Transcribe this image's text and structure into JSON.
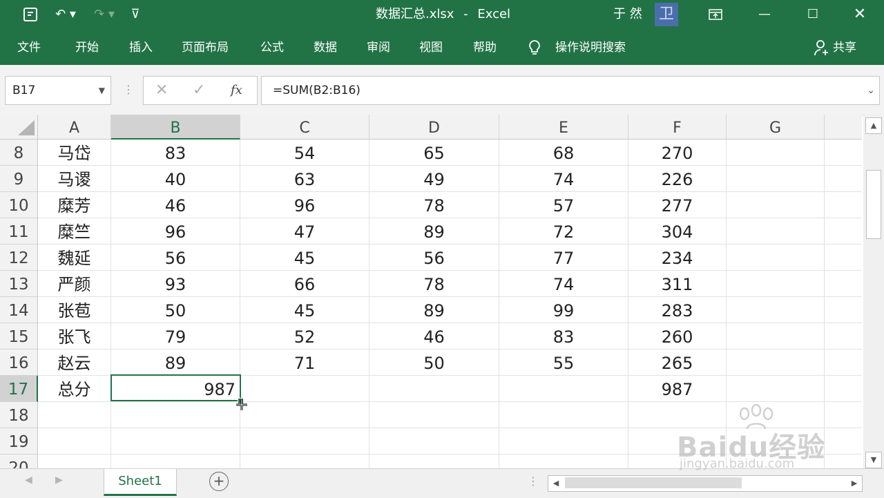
{
  "title_bar": {
    "filename": "数据汇总.xlsx",
    "separator": "-",
    "app": "Excel",
    "user": "于 然",
    "user_badge": "卫"
  },
  "ribbon": {
    "tabs": [
      "文件",
      "开始",
      "插入",
      "页面布局",
      "公式",
      "数据",
      "审阅",
      "视图",
      "帮助"
    ],
    "tell_me": "操作说明搜索",
    "share": "共享"
  },
  "formula_bar": {
    "name_box": "B17",
    "fx_label": "fx",
    "formula": "=SUM(B2:B16)"
  },
  "sheet": {
    "columns": [
      "A",
      "B",
      "C",
      "D",
      "E",
      "F",
      "G"
    ],
    "selected_column": "B",
    "selected_row": 17,
    "rows": [
      {
        "num": "8",
        "cells": [
          "马岱",
          "83",
          "54",
          "65",
          "68",
          "270",
          ""
        ]
      },
      {
        "num": "9",
        "cells": [
          "马谡",
          "40",
          "63",
          "49",
          "74",
          "226",
          ""
        ]
      },
      {
        "num": "10",
        "cells": [
          "糜芳",
          "46",
          "96",
          "78",
          "57",
          "277",
          ""
        ]
      },
      {
        "num": "11",
        "cells": [
          "糜竺",
          "96",
          "47",
          "89",
          "72",
          "304",
          ""
        ]
      },
      {
        "num": "12",
        "cells": [
          "魏延",
          "56",
          "45",
          "56",
          "77",
          "234",
          ""
        ]
      },
      {
        "num": "13",
        "cells": [
          "严颜",
          "93",
          "66",
          "78",
          "74",
          "311",
          ""
        ]
      },
      {
        "num": "14",
        "cells": [
          "张苞",
          "50",
          "45",
          "89",
          "99",
          "283",
          ""
        ]
      },
      {
        "num": "15",
        "cells": [
          "张飞",
          "79",
          "52",
          "46",
          "83",
          "260",
          ""
        ]
      },
      {
        "num": "16",
        "cells": [
          "赵云",
          "89",
          "71",
          "50",
          "55",
          "265",
          ""
        ]
      },
      {
        "num": "17",
        "cells": [
          "总分",
          "987",
          "",
          "",
          "",
          "987",
          ""
        ]
      },
      {
        "num": "18",
        "cells": [
          "",
          "",
          "",
          "",
          "",
          "",
          ""
        ]
      },
      {
        "num": "19",
        "cells": [
          "",
          "",
          "",
          "",
          "",
          "",
          ""
        ]
      },
      {
        "num": "20",
        "cells": [
          "",
          "",
          "",
          "",
          "",
          "",
          ""
        ]
      }
    ]
  },
  "tabs_bar": {
    "sheet_tab": "Sheet1",
    "add_sheet": "⊕"
  },
  "watermark": {
    "brand": "Baidu经验",
    "url": "jingyan.baidu.com"
  },
  "colors": {
    "excel_green": "#217346",
    "header_bg": "#f2f2f2"
  }
}
